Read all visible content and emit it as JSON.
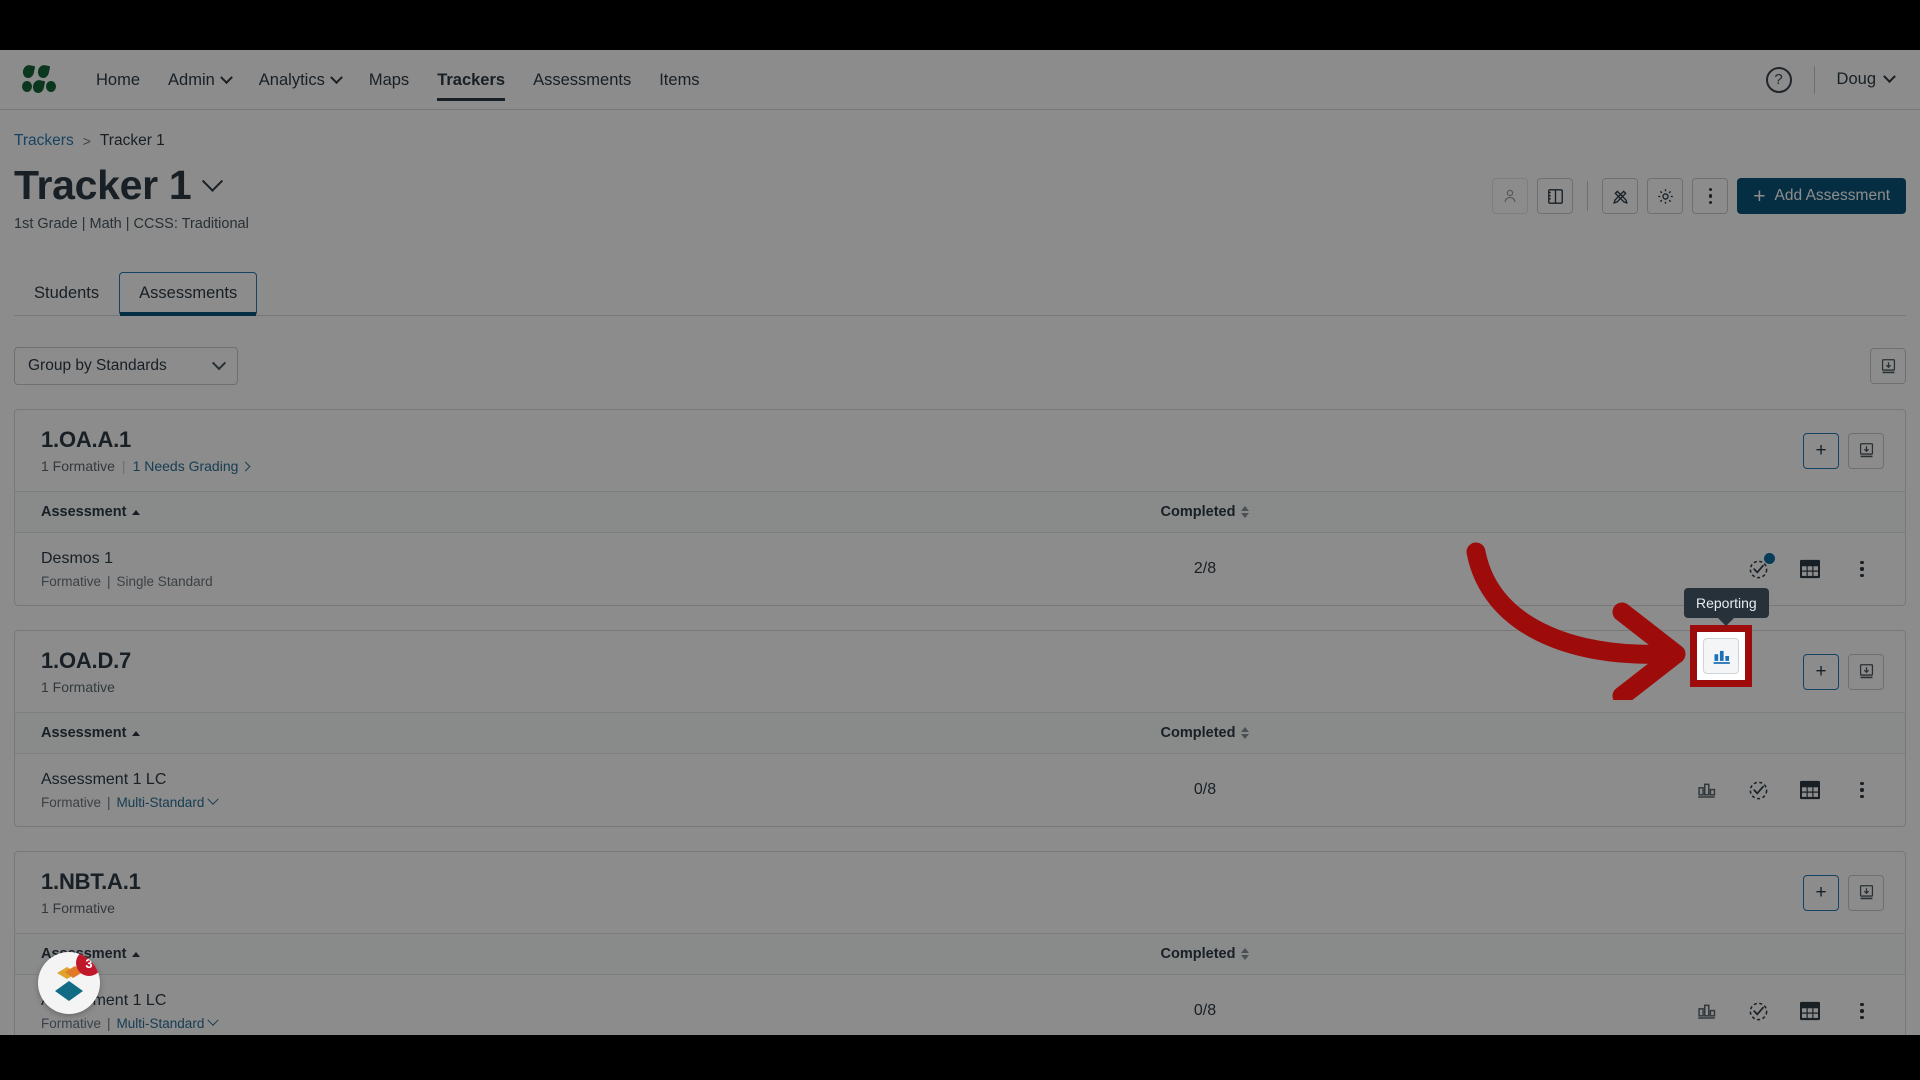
{
  "app": {
    "logo_icon": "mastery-droplets-logo",
    "brand_color": "#17653a",
    "accent_blue": "#0b5578",
    "link_blue": "#2b7ab3",
    "highlight_red": "#9e0b0b"
  },
  "topnav": {
    "items": [
      {
        "label": "Home",
        "has_caret": false,
        "active": false
      },
      {
        "label": "Admin",
        "has_caret": true,
        "active": false
      },
      {
        "label": "Analytics",
        "has_caret": true,
        "active": false
      },
      {
        "label": "Maps",
        "has_caret": false,
        "active": false
      },
      {
        "label": "Trackers",
        "has_caret": false,
        "active": true
      },
      {
        "label": "Assessments",
        "has_caret": false,
        "active": false
      },
      {
        "label": "Items",
        "has_caret": false,
        "active": false
      }
    ],
    "help_icon": "?",
    "user_label": "Doug"
  },
  "breadcrumb": {
    "root": "Trackers",
    "separator": ">",
    "current": "Tracker 1"
  },
  "header": {
    "title": "Tracker 1",
    "subtitle": "1st Grade | Math | CCSS: Traditional",
    "actions": [
      {
        "name": "student-roster-button",
        "icon": "person-icon",
        "disabled": true
      },
      {
        "name": "panel-toggle-button",
        "icon": "notebook-panel-icon",
        "disabled": false
      },
      {
        "name": "edit-tools-button",
        "icon": "pencil-ruler-icon",
        "disabled": false
      },
      {
        "name": "settings-button",
        "icon": "gear-icon",
        "disabled": false
      },
      {
        "name": "more-options-button",
        "icon": "kebab-icon",
        "disabled": false
      }
    ],
    "add_assessment_label": "Add Assessment",
    "add_assessment_plus": "+"
  },
  "tabs": [
    {
      "label": "Students",
      "active": false
    },
    {
      "label": "Assessments",
      "active": true
    }
  ],
  "filter_bar": {
    "group_select_value": "Group by Standards",
    "export_icon": "download-icon"
  },
  "columns": {
    "assessment": "Assessment",
    "completed": "Completed"
  },
  "cards": [
    {
      "code": "1.OA.A.1",
      "formative_count": "1 Formative",
      "separator": "|",
      "needs_grading": "1 Needs Grading",
      "has_needs_grading": true,
      "add_label": "+",
      "rows": [
        {
          "name": "Desmos 1",
          "type": "Formative",
          "standard_kind": "Single Standard",
          "standard_kind_is_link": false,
          "completed": "2/8",
          "reporting_highlighted": true,
          "grading_badge": true
        }
      ]
    },
    {
      "code": "1.OA.D.7",
      "formative_count": "1 Formative",
      "separator": "",
      "needs_grading": "",
      "has_needs_grading": false,
      "add_label": "+",
      "rows": [
        {
          "name": "Assessment 1 LC",
          "type": "Formative",
          "standard_kind": "Multi-Standard",
          "standard_kind_is_link": true,
          "completed": "0/8",
          "reporting_highlighted": false,
          "grading_badge": false
        }
      ]
    },
    {
      "code": "1.NBT.A.1",
      "formative_count": "1 Formative",
      "separator": "",
      "needs_grading": "",
      "has_needs_grading": false,
      "add_label": "+",
      "rows": [
        {
          "name": "Assessment 1 LC",
          "type": "Formative",
          "standard_kind": "Multi-Standard",
          "standard_kind_is_link": true,
          "completed": "0/8",
          "reporting_highlighted": false,
          "grading_badge": false
        }
      ]
    }
  ],
  "tooltip": {
    "text": "Reporting"
  },
  "annotation": {
    "arrow_color": "#9e0b0b",
    "highlight_border_color": "#9e0b0b"
  },
  "chat_widget": {
    "badge_count": "3",
    "icon": "diamond-chat-logo"
  },
  "row_action_icons": {
    "reporting": "bar-chart-icon",
    "grading": "checkmark-circle-icon",
    "grid": "grid-table-icon",
    "more": "kebab-icon"
  }
}
